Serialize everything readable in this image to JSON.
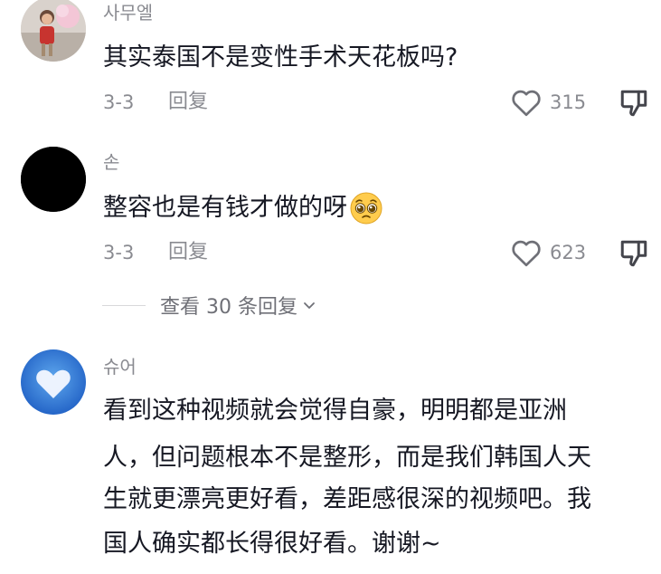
{
  "comments": [
    {
      "username": "사무엘",
      "text": "其实泰国不是变性手术天花板吗?",
      "date": "3-3",
      "reply_label": "回复",
      "likes": "315",
      "avatar": "child-photo"
    },
    {
      "username": "손",
      "text": "整容也是有钱才做的呀",
      "emoji": "🥺",
      "date": "3-3",
      "reply_label": "回复",
      "likes": "623",
      "avatar": "black-circle"
    },
    {
      "username": "슈어",
      "lines": [
        "看到这种视频就会觉得自豪，明明都是亚洲",
        "人，但问题根本不是整形，而是我们韩国人天",
        "生就更漂亮更好看，差距感很深的视频吧。我",
        "国人确实都长得很好看。谢谢~"
      ],
      "avatar": "heart-cloud"
    }
  ],
  "view_replies": {
    "label": "查看 30 条回复"
  },
  "colors": {
    "text_primary": "#161823",
    "text_secondary": "#8a8b91",
    "divider": "#d8d8da"
  }
}
